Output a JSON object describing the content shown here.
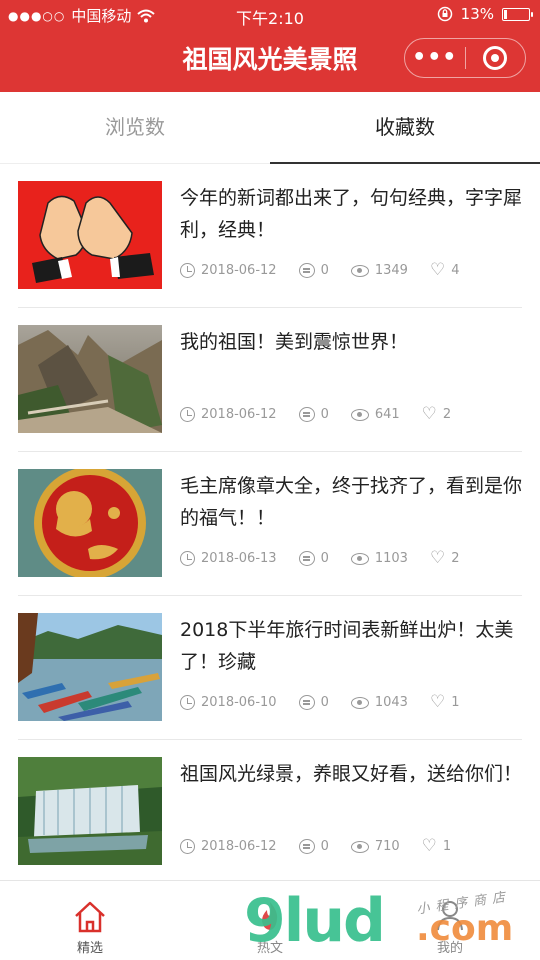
{
  "status": {
    "carrier": "中国移动",
    "time": "下午2:10",
    "battery": "13%",
    "battery_level": 0.13
  },
  "header": {
    "title": "祖国风光美景照",
    "more": "•••"
  },
  "tabs": [
    {
      "label": "浏览数",
      "active": false
    },
    {
      "label": "收藏数",
      "active": true
    }
  ],
  "articles": [
    {
      "title": "今年的新词都出来了，句句经典，字字犀利，经典！",
      "date": "2018-06-12",
      "comments": "0",
      "views": "1349",
      "likes": "4",
      "image": "clapping-hands"
    },
    {
      "title": "我的祖国！美到震惊世界！",
      "date": "2018-06-12",
      "comments": "0",
      "views": "641",
      "likes": "2",
      "image": "mountain-valley"
    },
    {
      "title": "毛主席像章大全，终于找齐了，看到是你的福气！！",
      "date": "2018-06-13",
      "comments": "0",
      "views": "1103",
      "likes": "2",
      "image": "badge"
    },
    {
      "title": "2018下半年旅行时间表新鲜出炉！太美了！珍藏",
      "date": "2018-06-10",
      "comments": "0",
      "views": "1043",
      "likes": "1",
      "image": "lake-boats"
    },
    {
      "title": "祖国风光绿景，养眼又好看，送给你们！",
      "date": "2018-06-12",
      "comments": "0",
      "views": "710",
      "likes": "1",
      "image": "waterfall"
    }
  ],
  "tabbar": [
    {
      "label": "精选",
      "icon": "home-icon"
    },
    {
      "label": "热文",
      "icon": "fire-icon"
    },
    {
      "label": "我的",
      "icon": "user-icon"
    }
  ],
  "watermark": {
    "brand": "9lud",
    "domain": ".com",
    "tagline": "小程序商店"
  },
  "colors": {
    "brand": "#dd3634",
    "text": "#222222",
    "muted": "#999999"
  }
}
